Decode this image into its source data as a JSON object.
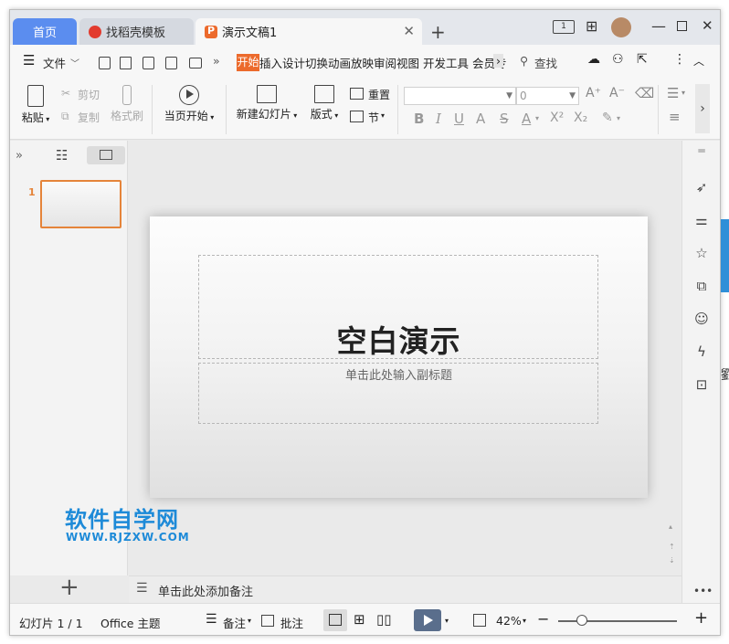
{
  "tabs": {
    "home": "首页",
    "template": "找稻壳模板",
    "doc": "演示文稿1"
  },
  "menu": {
    "file": "文件",
    "start": "开始",
    "items": "插入设计切换动画放映审阅视图 开发工具 会员专",
    "search": "查找"
  },
  "ribbon": {
    "paste": "粘贴",
    "cut": "剪切",
    "copy": "复制",
    "format_painter": "格式刷",
    "play_from_current": "当页开始",
    "new_slide": "新建幻灯片",
    "layout": "版式",
    "reset": "重置",
    "section": "节",
    "font_size": "0"
  },
  "slide": {
    "number": "1",
    "title": "空白演示",
    "subtitle": "单击此处输入副标题"
  },
  "notes": "单击此处添加备注",
  "watermark": {
    "cn": "软件自学网",
    "url": "WWW.RJZXW.COM"
  },
  "status": {
    "slide_count": "幻灯片 1 / 1",
    "theme": "Office 主题",
    "notes_btn": "备注",
    "comments_btn": "批注",
    "zoom": "42%"
  },
  "colors": {
    "accent": "#5b8def",
    "orange": "#ec6a2c",
    "watermark": "#1d8ad8"
  }
}
